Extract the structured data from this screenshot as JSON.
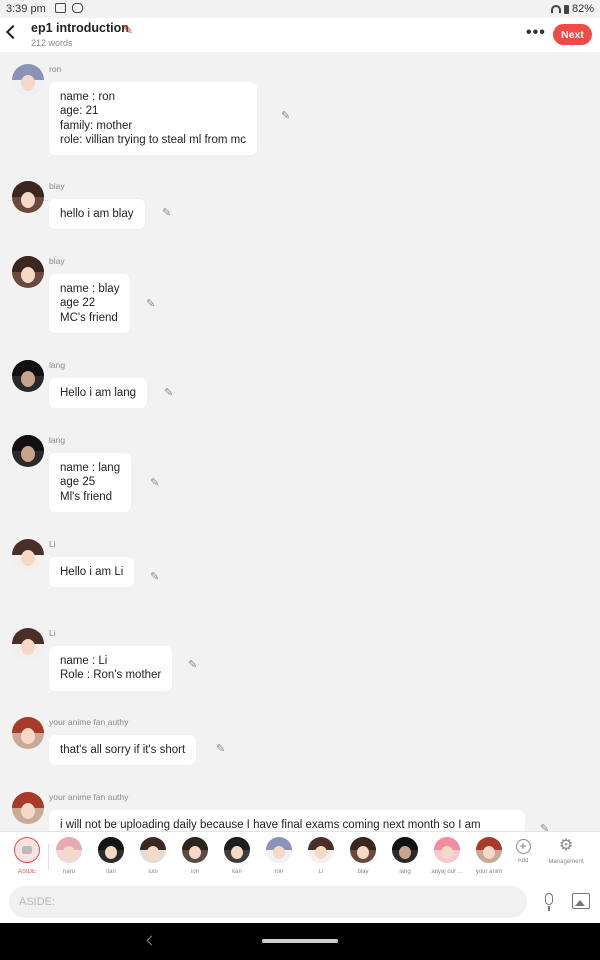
{
  "status_bar": {
    "time": "3:39 pm",
    "battery": "82%"
  },
  "header": {
    "title": "ep1 introduction",
    "word_count": "212 words",
    "next_label": "Next",
    "more_icon": "more-horizontal-icon"
  },
  "messages": [
    {
      "speaker": "ron",
      "text": "name : ron\nage: 21\nfamily: mother\nrole: villian trying to steal ml from mc"
    },
    {
      "speaker": "blay",
      "text": "hello i am blay"
    },
    {
      "speaker": "blay",
      "text": "name : blay\nage 22\nMC's friend"
    },
    {
      "speaker": "lang",
      "text": "Hello i am lang"
    },
    {
      "speaker": "lang",
      "text": "name : lang\nage 25\nMl's friend"
    },
    {
      "speaker": "Li",
      "text": "Hello i am Li\n "
    },
    {
      "speaker": "Li",
      "text": "name : Li\nRole : Ron's mother"
    },
    {
      "speaker": "your anime fan authy",
      "text": "that's all sorry if it's short"
    },
    {
      "speaker": "your anime fan authy",
      "text": "i will not be uploading daily because I have final exams coming next month so I am"
    }
  ],
  "cast": [
    {
      "label": "ASIDE"
    },
    {
      "label": "haru"
    },
    {
      "label": "itan"
    },
    {
      "label": "luoi"
    },
    {
      "label": "lon"
    },
    {
      "label": "kan"
    },
    {
      "label": "ron"
    },
    {
      "label": "Li"
    },
    {
      "label": "blay"
    },
    {
      "label": "lang"
    },
    {
      "label": "anyaj our ..."
    },
    {
      "label": "your anim"
    },
    {
      "label": "Add"
    },
    {
      "label": "Management"
    }
  ],
  "input": {
    "placeholder": "ASIDE:"
  },
  "colors": {
    "accent": "#ef4a43",
    "background": "#f2f2f2",
    "bubble": "#ffffff"
  }
}
